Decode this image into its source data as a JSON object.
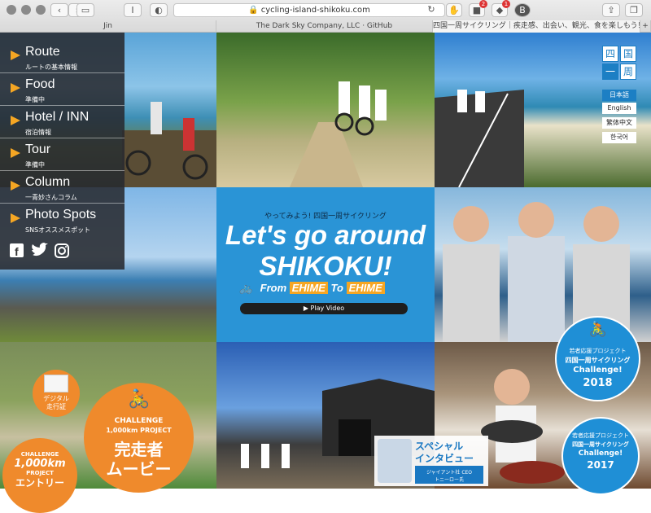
{
  "browser": {
    "url": "cycling-island-shikoku.com",
    "reader_label": "I",
    "tabs": [
      "Jin",
      "The Dark Sky Company, LLC · GitHub",
      "四国一周サイクリング｜疾走感、出会い、観光、食を楽しもう！"
    ],
    "badge_counts": [
      "2",
      "1"
    ],
    "avatar_letter": "B",
    "new_tab": "+"
  },
  "menu": {
    "items": [
      {
        "title": "Route",
        "sub": "ルートの基本情報"
      },
      {
        "title": "Food",
        "sub": "準備中"
      },
      {
        "title": "Hotel / INN",
        "sub": "宿泊情報"
      },
      {
        "title": "Tour",
        "sub": "準備中"
      },
      {
        "title": "Column",
        "sub": "一青妙さんコラム"
      },
      {
        "title": "Photo Spots",
        "sub": "SNSオススメスポット"
      }
    ],
    "social": [
      "facebook-icon",
      "twitter-icon",
      "instagram-icon"
    ]
  },
  "logo": {
    "chars": [
      "四",
      "国",
      "一",
      "周"
    ]
  },
  "languages": [
    "日本語",
    "English",
    "繁体中文",
    "한국어"
  ],
  "hero": {
    "kicker": "やってみよう! 四国一周サイクリング",
    "line1": "Let's go around",
    "line2": "SHIKOKU!",
    "from": "From",
    "from_place": "EHIME",
    "to": "To",
    "to_place": "EHIME",
    "play": "Play Video"
  },
  "challenge": {
    "map_label_1": "デジタル",
    "map_label_2": "走行証",
    "big_1": "CHALLENGE",
    "big_2": "1,000km PROJECT",
    "big_3": "完走者",
    "big_4": "ムービー",
    "small_1": "CHALLENGE",
    "small_2": "1,000km",
    "small_3": "PROJECT",
    "small_4": "エントリー"
  },
  "interview": {
    "line1": "スペシャル",
    "line2": "インタビュー",
    "caption1": "ジャイアント社 CEO",
    "caption2": "トニーロー氏"
  },
  "badge2018": {
    "l1": "若者応援プロジェクト",
    "l2": "四国一周サイクリング",
    "l3": "Challenge!",
    "l4": "2018"
  },
  "badge2017": {
    "l1": "若者応援プロジェクト",
    "l2": "四国一周サイクリング",
    "l3": "Challenge!",
    "l4": "2017"
  },
  "colors": {
    "accent": "#f5a623",
    "hero": "#2a94d6",
    "logo_blue": "#1c7fc4",
    "badge_blue": "#1f8fd6",
    "orange": "#ef8a2c"
  }
}
